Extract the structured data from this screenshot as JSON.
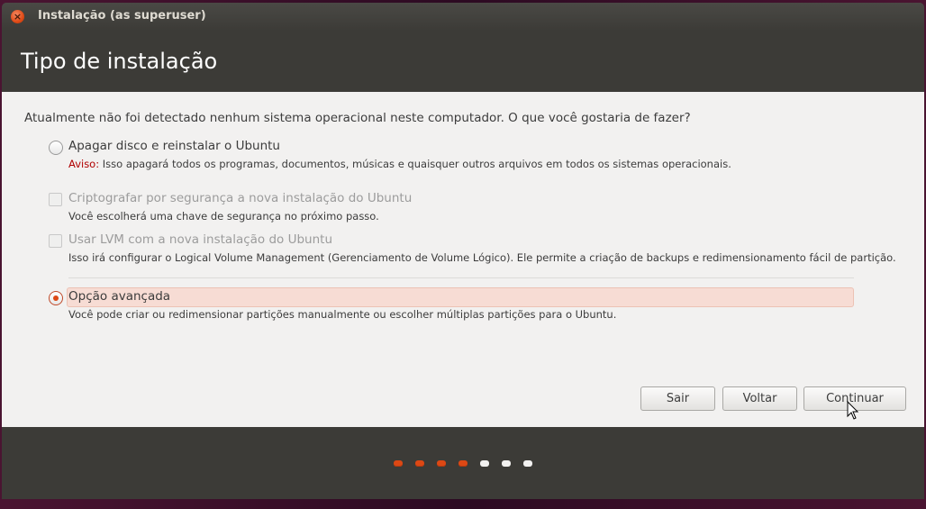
{
  "window": {
    "title": "Instalação (as superuser)",
    "close_icon": "×"
  },
  "header": {
    "title": "Tipo de instalação"
  },
  "main": {
    "question": "Atualmente não foi detectado nenhum sistema operacional neste computador. O que você gostaria de fazer?",
    "options": [
      {
        "type": "radio",
        "label": "Apagar disco e reinstalar o Ubuntu",
        "warning_prefix": "Aviso:",
        "description": " Isso apagará todos os programas, documentos, músicas e quaisquer outros arquivos em todos os sistemas operacionais.",
        "checked": false,
        "enabled": true
      },
      {
        "type": "checkbox",
        "label": "Criptografar por segurança a nova instalação do Ubuntu",
        "description": "Você escolherá uma chave de segurança no próximo passo.",
        "checked": false,
        "enabled": false
      },
      {
        "type": "checkbox",
        "label": "Usar LVM com a nova instalação do Ubuntu",
        "description": "Isso irá configurar o Logical Volume Management (Gerenciamento de Volume Lógico). Ele permite a criação de backups e redimensionamento fácil de partição.",
        "checked": false,
        "enabled": false
      },
      {
        "type": "radio",
        "label": "Opção avançada",
        "description": "Você pode criar ou redimensionar partições manualmente ou escolher múltiplas partições para o Ubuntu.",
        "checked": true,
        "enabled": true
      }
    ]
  },
  "buttons": {
    "quit": "Sair",
    "back": "Voltar",
    "continue": "Continuar"
  },
  "progress": {
    "total_steps": 7,
    "completed_steps": 4
  },
  "colors": {
    "accent": "#dd4814",
    "warning": "#b00000",
    "window_dark": "#3c3b37",
    "content_bg": "#f2f1f0"
  }
}
